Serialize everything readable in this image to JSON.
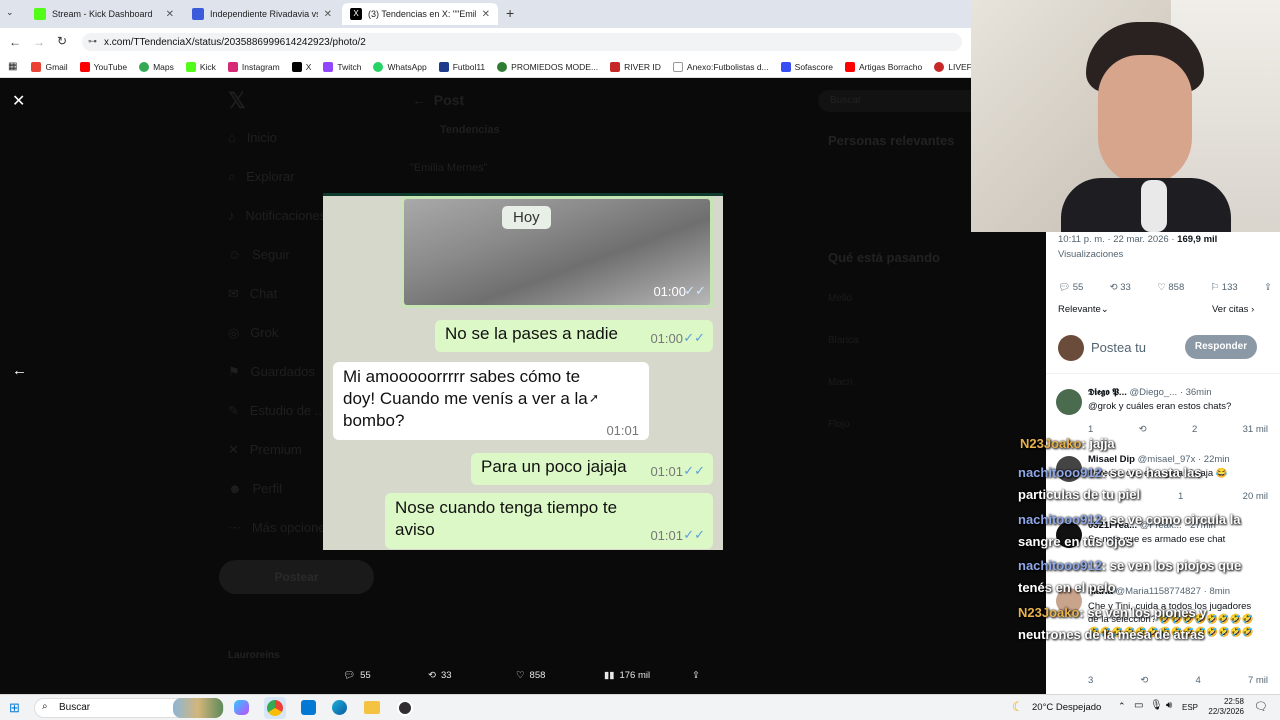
{
  "browser": {
    "tabs": [
      {
        "title": "Stream - Kick Dashboard",
        "color": "#53fc18"
      },
      {
        "title": "Independiente Rivadavia vs Ro",
        "color": "#3b5bdb"
      },
      {
        "title": "(3) Tendencias en X: \"\"Emilia M",
        "color": "#000000"
      }
    ],
    "url": "x.com/TTendenciaX/status/2035886999614242923/photo/2",
    "bookmarks": [
      "Gmail",
      "YouTube",
      "Maps",
      "Kick",
      "Instagram",
      "X",
      "Twitch",
      "WhatsApp",
      "Futbol11",
      "PROMIEDOS MODE...",
      "RIVER ID",
      "Anexo:Futbolistas d...",
      "Sofascore",
      "Artigas Borracho",
      "LIVEFUTBOL"
    ]
  },
  "x_nav": {
    "items": [
      "Inicio",
      "Explorar",
      "Notificaciones",
      "Seguir",
      "Chat",
      "Grok",
      "Guardados",
      "Estudio de ...",
      "Premium",
      "Perfil",
      "Más opciones"
    ],
    "post_button": "Postear",
    "header": "Post",
    "user_name": "Tendencias",
    "user_handle": "@TTendenciaX",
    "post_text": "\"Emilia Mernes\"",
    "account": "Lauroreins"
  },
  "x_right": {
    "search": "Buscar",
    "relevant_title": "Personas relevantes",
    "trending_title": "Qué está pasando",
    "trends": [
      "Mello",
      "Blanca",
      "Macri",
      "Flojo"
    ]
  },
  "chat_image": {
    "date_badge": "Hoy",
    "photo_time": "01:00",
    "messages": [
      {
        "text": "No se la pases a nadie",
        "time": "01:00",
        "side": "out"
      },
      {
        "text": "Mi amooooorrrrr sabes cómo te doy! Cuando me venís a ver a la bombo?",
        "time": "01:01",
        "side": "in"
      },
      {
        "text": "Para un poco jajaja",
        "time": "01:01",
        "side": "out"
      },
      {
        "text": "Nose cuando tenga tiempo te aviso",
        "time": "01:01",
        "side": "out"
      }
    ]
  },
  "photo_actions": {
    "replies": "55",
    "reposts": "33",
    "likes": "858",
    "views": "176 mil"
  },
  "post_panel": {
    "timestamp": "10:11 p. m. · 22 mar. 2026 ·",
    "views_count": "169,9 mil",
    "views_label": "Visualizaciones",
    "replies": "55",
    "reposts": "33",
    "likes": "858",
    "bookmarks": "133",
    "sort_label": "Relevante",
    "quotes_link": "Ver citas",
    "compose_placeholder": "Postea tu",
    "reply_button": "Responder",
    "replies_list": [
      {
        "name": "𝕯𝖎𝖊𝖌𝖔 𝕻...",
        "handle": "@Diego_...",
        "time": "· 36min",
        "text": "@grok y cuáles eran estos chats?",
        "r": "1",
        "l": "2",
        "v": "31 mil"
      },
      {
        "name": "Misael Dip",
        "handle": "@misael_97x",
        "time": "· 22min",
        "text": "Paredes con esta gata! Jajaja 😂",
        "r": "",
        "l": "1",
        "v": "20 mil"
      },
      {
        "name": "0321Frea...",
        "handle": "@Freak...",
        "time": "· 27min",
        "text": "Se nota que es armado ese chat",
        "r": "",
        "l": "",
        "v": ""
      },
      {
        "name": "María",
        "handle": "@Maria1158774827",
        "time": "· 8min",
        "text": "Che y Tini, cuida a todos los jugadores de la selección? 🤣🤣🤣🤣🤣🤣🤣🤣🤣🤣🤣🤣🤣🤣🤣🤣🤣🤣🤣🤣🤣🤣",
        "r": "3",
        "l": "4",
        "v": "7 mil"
      }
    ]
  },
  "stream_chat": [
    {
      "user": "N23Joako",
      "msg": ": jajja",
      "color": "#e8b14a"
    },
    {
      "user": "nachitooo912",
      "msg": ": se ve hasta las particulas de tu piel",
      "color": "#8fa8e8"
    },
    {
      "user": "nachitooo912",
      "msg": ": se ve como circula la sangre en tus ojos",
      "color": "#8fa8e8"
    },
    {
      "user": "nachitooo912",
      "msg": ": se ven los piojos que tenés en el pelo",
      "color": "#8fa8e8"
    },
    {
      "user": "N23Joako",
      "msg": ": se ven los piones y neutrones de la mesa de atras",
      "color": "#e8b14a"
    }
  ],
  "taskbar": {
    "search": "Buscar",
    "weather": "20°C  Despejado",
    "lang": "ESP",
    "time": "22:58",
    "date": "22/3/2026"
  }
}
